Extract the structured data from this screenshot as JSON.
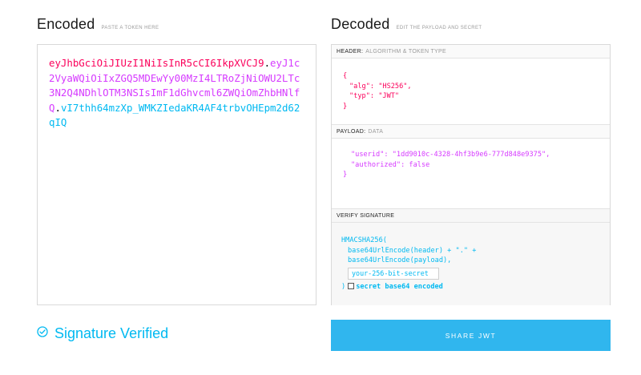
{
  "encoded": {
    "title": "Encoded",
    "subtitle": "PASTE A TOKEN HERE",
    "token_header": "eyJhbGciOiJIUzI1NiIsInR5cCI6IkpXVCJ9",
    "token_payload": "eyJ1c2VyaWQiOiIxZGQ5MDEwYy00MzI4LTRoZjNiOWU2LTc3N2Q4NDhlOTM3NSIsImF1dGhvcml6ZWQiOmZhbHNlfQ",
    "token_signature": "vI7thh64mzXp_WMKZIedaKR4AF4trbvOHEpm2d62qIQ",
    "dot": "."
  },
  "decoded": {
    "title": "Decoded",
    "subtitle": "EDIT THE PAYLOAD AND SECRET",
    "header_section": {
      "label": "HEADER:",
      "hint": "ALGORITHM & TOKEN TYPE",
      "open_brace": "{",
      "close_brace": "}",
      "line1": "\"alg\": \"HS256\",",
      "line2": "\"typ\": \"JWT\""
    },
    "payload_section": {
      "label": "PAYLOAD:",
      "hint": "DATA",
      "open_brace": "{",
      "close_brace": "}",
      "line1": "\"userid\": \"1dd9010c-4328-4hf3b9e6-777d848e9375\",",
      "line2": "\"authorized\": false"
    },
    "verify_section": {
      "label": "VERIFY SIGNATURE",
      "line1": "HMACSHA256(",
      "line2": "base64UrlEncode(header) + \".\" +",
      "line3": "base64UrlEncode(payload),",
      "secret_value": "your-256-bit-secret",
      "close_paren": ")",
      "checkbox_label": "secret base64 encoded"
    }
  },
  "status": {
    "verified_text": "Signature Verified",
    "icon": "check-circle-icon",
    "color": "#00b9f1"
  },
  "share": {
    "label": "SHARE JWT",
    "color": "#30b6ee"
  }
}
